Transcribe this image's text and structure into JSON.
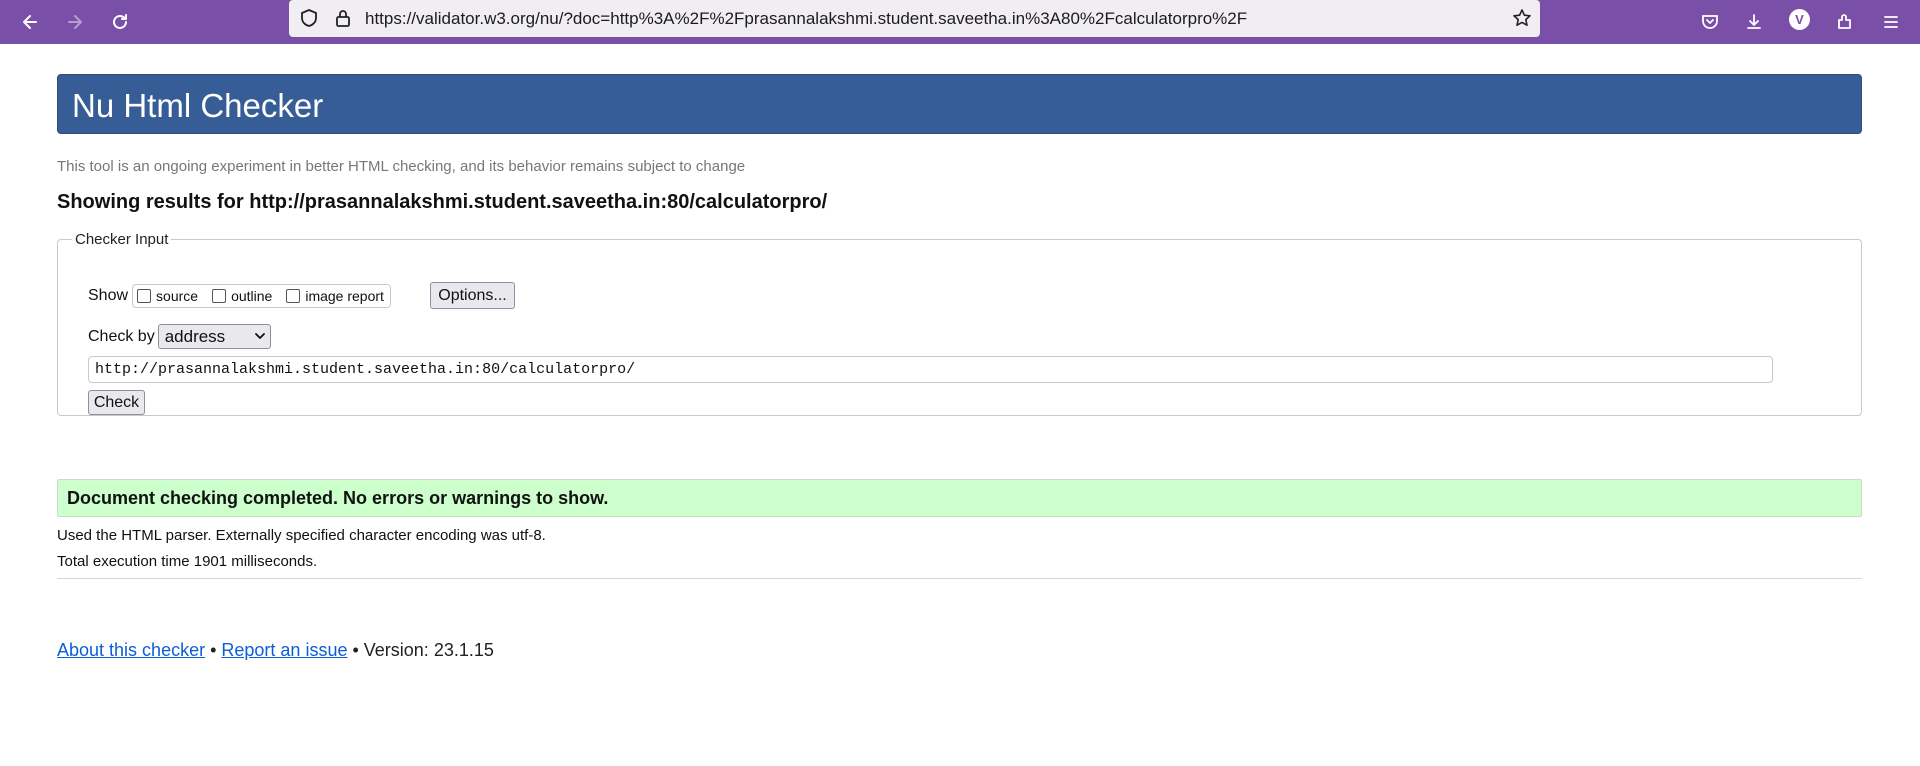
{
  "browser": {
    "url": "https://validator.w3.org/nu/?doc=http%3A%2F%2Fprasannalakshmi.student.saveetha.in%3A80%2Fcalculatorpro%2F",
    "avatar_letter": "V",
    "accent_color": "#7a4fa8"
  },
  "page": {
    "banner_title": "Nu Html Checker",
    "subtitle": "This tool is an ongoing experiment in better HTML checking, and its behavior remains subject to change",
    "results_heading": "Showing results for http://prasannalakshmi.student.saveetha.in:80/calculatorpro/",
    "checker": {
      "legend": "Checker Input",
      "show_label": "Show",
      "show_options": [
        "source",
        "outline",
        "image report"
      ],
      "options_button": "Options...",
      "check_by_label": "Check by",
      "check_by_value": "address",
      "url_value": "http://prasannalakshmi.student.saveetha.in:80/calculatorpro/",
      "check_button": "Check"
    },
    "result_message": "Document checking completed. No errors or warnings to show.",
    "info_parser": "Used the HTML parser. Externally specified character encoding was utf-8.",
    "info_time": "Total execution time 1901 milliseconds.",
    "footer": {
      "about_link": "About this checker",
      "sep1": " • ",
      "report_link": "Report an issue",
      "version_text": " • Version: 23.1.15"
    }
  }
}
